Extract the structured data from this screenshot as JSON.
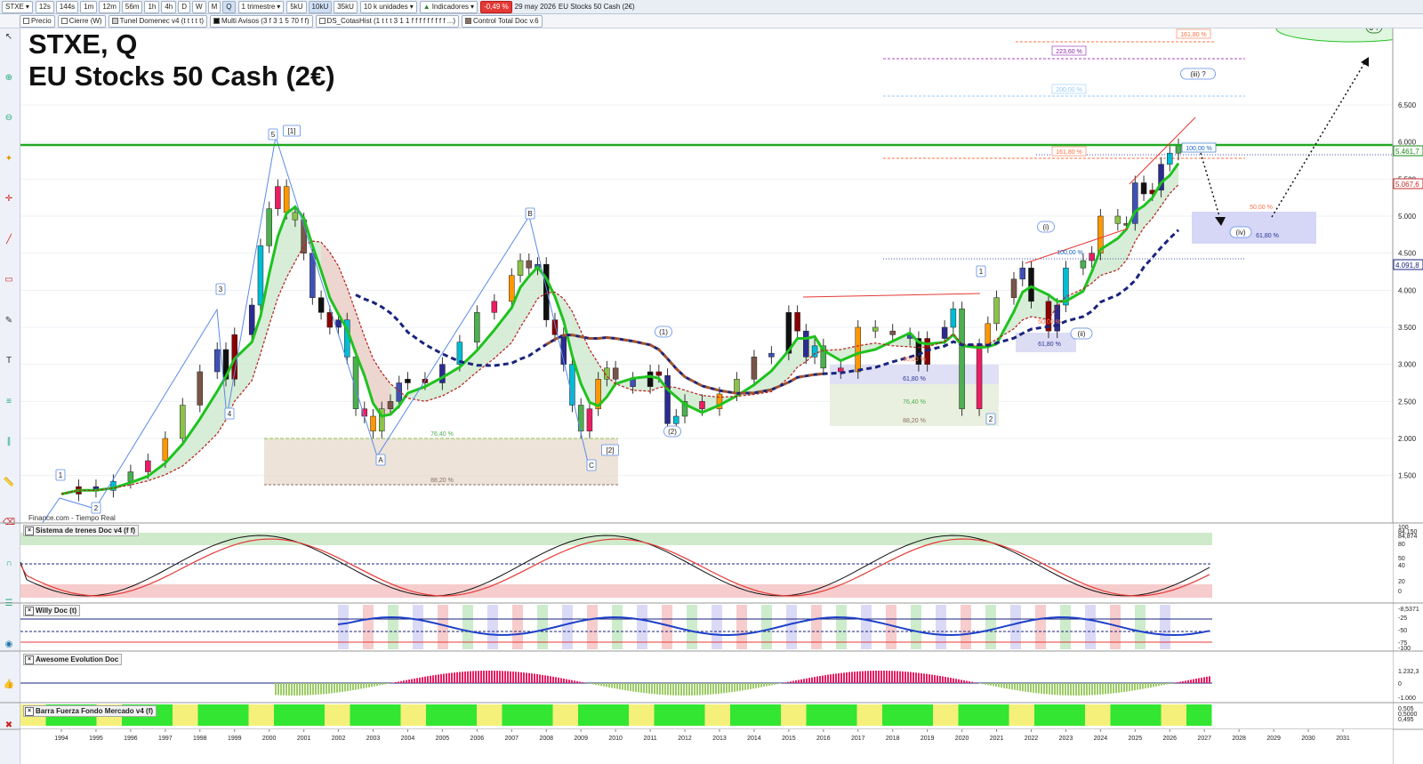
{
  "toolbar": {
    "symbol": "STXE",
    "timeframes": [
      "12s",
      "144s",
      "1m",
      "12m",
      "56m",
      "1h",
      "4h",
      "D",
      "W",
      "M",
      "Q"
    ],
    "active_timeframe": "Q",
    "period": "1 trimestre",
    "zoom_buttons": [
      "5kU",
      "10kU",
      "35kU"
    ],
    "units": "10 k unidades",
    "indicators_label": "Indicadores",
    "change_badge": "-0,49 %",
    "date": "29 may 2026",
    "instrument": "EU Stocks 50 Cash (2€)"
  },
  "toolbar2": {
    "items": [
      "Precio",
      "Cierre (W)",
      "Tunel Domenec v4 (t t t t t)",
      "Multi Avisos (3 f 3 1 5 70 f f)",
      "DS_CotasHist (1 t t t 3 1 1 f f f f f f f f f ...)",
      "Control Total Doc v.6"
    ]
  },
  "title": {
    "line1": "STXE, Q",
    "line2": "EU Stocks 50 Cash (2€)"
  },
  "source": "Finance.com - Tiempo Real",
  "price_axis": {
    "ticks": [
      "6.500",
      "6.000",
      "5.500",
      "5.000",
      "4.500",
      "4.000",
      "3.500",
      "3.000",
      "2.500",
      "2.000",
      "1.500"
    ],
    "markers": [
      {
        "label": "5.461,7",
        "color": "#1a8a1a"
      },
      {
        "label": "5.067,6",
        "color": "#c62828"
      },
      {
        "label": "4.091,8",
        "color": "#1a237e"
      }
    ]
  },
  "fib_labels": {
    "top": [
      "161,80 %",
      "223,60 %",
      "200,00 %",
      "161,80 %",
      "100,00 %"
    ],
    "mid": [
      "50,00 %",
      "61,80 %",
      "100,00 %",
      "50,00 %",
      "61,80 %"
    ],
    "low": [
      "50,00 %",
      "61,80 %",
      "76,40 %",
      "88,20 %",
      "76,40 %",
      "88,20 %"
    ]
  },
  "wave_labels": [
    "1",
    "2",
    "3",
    "4",
    "5",
    "[1]",
    "A",
    "B",
    "C",
    "[2]",
    "(1)",
    "(2)",
    "1",
    "2",
    "(i)",
    "(ii)",
    "(iii) ?",
    "(iv)",
    "3 ?"
  ],
  "x_axis": {
    "years": [
      "1994",
      "1995",
      "1996",
      "1997",
      "1998",
      "1999",
      "2000",
      "2001",
      "2002",
      "2003",
      "2004",
      "2005",
      "2006",
      "2007",
      "2008",
      "2009",
      "2010",
      "2011",
      "2012",
      "2013",
      "2014",
      "2015",
      "2016",
      "2017",
      "2018",
      "2019",
      "2020",
      "2021",
      "2022",
      "2023",
      "2024",
      "2025",
      "2026",
      "2027",
      "2028",
      "2029",
      "2030",
      "2031"
    ]
  },
  "panels": [
    {
      "name": "Sistema de trenes Doc v4 (f f)",
      "axis": [
        "100",
        "84,150",
        "84,874",
        "80",
        "50",
        "40",
        "20",
        "0"
      ]
    },
    {
      "name": "Willy Doc (t)",
      "axis": [
        "-8,5371",
        "-25",
        "-50",
        "-75",
        "-100"
      ]
    },
    {
      "name": "Awesome Evolution Doc",
      "axis": [
        "1.232,3",
        "0",
        "-1.000"
      ]
    },
    {
      "name": "Barra Fuerza Fondo Mercado v4 (f)",
      "axis": [
        "0,505",
        "0,5000",
        "0,495"
      ]
    }
  ],
  "sidebar_icons": [
    "cursor-icon",
    "zoom-in-icon",
    "zoom-out-icon",
    "lightbulb-icon",
    "crosshair-icon",
    "line-tool-icon",
    "rectangle-tool-icon",
    "pencil-icon",
    "text-tool-icon",
    "fibonacci-icon",
    "parallel-lines-icon",
    "ruler-icon",
    "eraser-icon",
    "magnet-icon",
    "layers-icon",
    "eye-icon",
    "like-icon",
    "delete-icon"
  ]
}
